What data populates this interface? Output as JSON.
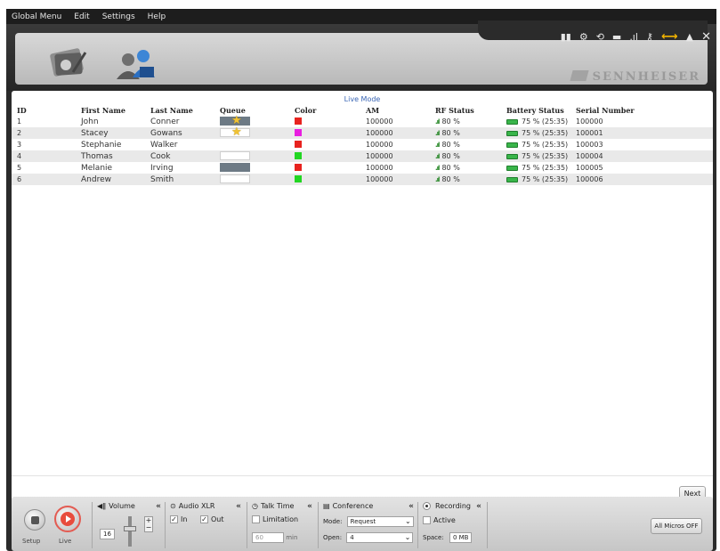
{
  "menu": [
    "Global Menu",
    "Edit",
    "Settings",
    "Help"
  ],
  "brand": "SENNHEISER",
  "toolbar_icons": [
    "signal-icon",
    "settings-icon",
    "refresh-icon",
    "battery-icon",
    "rf-icon",
    "key-icon",
    "link-icon",
    "warning-icon",
    "close-icon"
  ],
  "mode_label": "Live Mode",
  "columns": [
    "ID",
    "First Name",
    "Last Name",
    "Queue",
    "Color",
    "AM",
    "RF Status",
    "Battery Status",
    "Serial Number"
  ],
  "rows": [
    {
      "id": "1",
      "first": "John",
      "last": "Conner",
      "queue": "filled-star",
      "color": "#e8231f",
      "am": "100000",
      "rf": "80 %",
      "battery": "75 % (25:35)",
      "serial": "100000"
    },
    {
      "id": "2",
      "first": "Stacey",
      "last": "Gowans",
      "queue": "star",
      "color": "#e81ee0",
      "am": "100000",
      "rf": "80 %",
      "battery": "75 % (25:35)",
      "serial": "100001"
    },
    {
      "id": "3",
      "first": "Stephanie",
      "last": "Walker",
      "queue": "none",
      "color": "#e8231f",
      "am": "100000",
      "rf": "80 %",
      "battery": "75 % (25:35)",
      "serial": "100003"
    },
    {
      "id": "4",
      "first": "Thomas",
      "last": "Cook",
      "queue": "empty",
      "color": "#22d622",
      "am": "100000",
      "rf": "80 %",
      "battery": "75 % (25:35)",
      "serial": "100004"
    },
    {
      "id": "5",
      "first": "Melanie",
      "last": "Irving",
      "queue": "filled",
      "color": "#e8231f",
      "am": "100000",
      "rf": "80 %",
      "battery": "75 % (25:35)",
      "serial": "100005"
    },
    {
      "id": "6",
      "first": "Andrew",
      "last": "Smith",
      "queue": "empty",
      "color": "#22d622",
      "am": "100000",
      "rf": "80 %",
      "battery": "75 % (25:35)",
      "serial": "100006"
    }
  ],
  "next_label": "Next",
  "bottom": {
    "setup_label": "Setup",
    "live_label": "Live",
    "volume_title": "Volume",
    "volume_value": "16",
    "audio_title": "Audio XLR",
    "audio_in": "In",
    "audio_out": "Out",
    "talk_title": "Talk Time",
    "limitation": "Limitation",
    "talk_value": "60",
    "talk_unit": "min",
    "conf_title": "Conference",
    "mode_label": "Mode:",
    "mode_value": "Request",
    "open_label": "Open:",
    "open_value": "4",
    "rec_title": "Recording",
    "rec_active": "Active",
    "space_label": "Space:",
    "space_value": "0 MB",
    "all_micros": "All Micros OFF"
  }
}
